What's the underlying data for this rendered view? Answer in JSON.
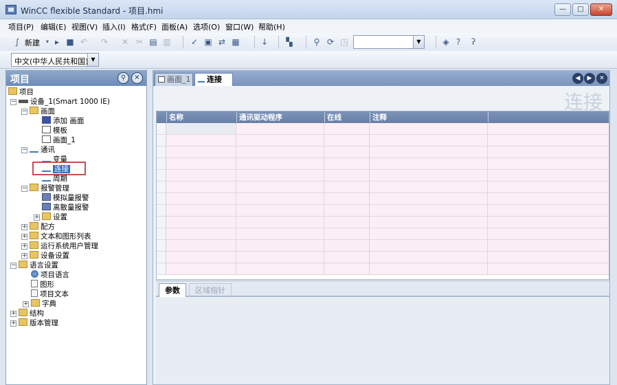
{
  "window": {
    "title": "WinCC flexible Standard - 项目.hmi",
    "controls": [
      "—",
      "□",
      "✕"
    ]
  },
  "menu": [
    "项目(P)",
    "编辑(E)",
    "视图(V)",
    "插入(I)",
    "格式(F)",
    "面板(A)",
    "选项(O)",
    "窗口(W)",
    "帮助(H)"
  ],
  "toolbar": {
    "new_label": "新建",
    "icons": [
      "new-connection-icon",
      "open-icon",
      "save-icon",
      "undo-icon",
      "redo-icon",
      "delete-icon",
      "copy-icon",
      "paste-icon",
      "check-icon",
      "compile-icon",
      "transfer-icon",
      "simulate-icon",
      "download-icon",
      "library-icon",
      "search-icon",
      "link-icon",
      "help-icon"
    ],
    "combo_empty": "",
    "language": "中文(中华人民共和国)"
  },
  "project": {
    "panel_title": "项目",
    "tree": [
      {
        "label": "项目",
        "icon": "project-icon"
      },
      {
        "label": "设备_1(Smart 1000 IE)",
        "icon": "device-icon"
      },
      {
        "label": "画面",
        "icon": "folder-icon"
      },
      {
        "label": "添加 画面",
        "icon": "add-screen-icon"
      },
      {
        "label": "模板",
        "icon": "screen-icon"
      },
      {
        "label": "画面_1",
        "icon": "screen-icon"
      },
      {
        "label": "通讯",
        "icon": "communication-icon"
      },
      {
        "label": "变量",
        "icon": "tag-icon"
      },
      {
        "label": "连接",
        "icon": "connection-icon"
      },
      {
        "label": "周期",
        "icon": "cycle-icon"
      },
      {
        "label": "报警管理",
        "icon": "folder-icon"
      },
      {
        "label": "模拟量报警",
        "icon": "alarm-icon"
      },
      {
        "label": "离散量报警",
        "icon": "alarm-icon"
      },
      {
        "label": "设置",
        "icon": "settings-icon"
      },
      {
        "label": "配方",
        "icon": "folder-icon"
      },
      {
        "label": "文本和图形列表",
        "icon": "folder-icon"
      },
      {
        "label": "运行系统用户管理",
        "icon": "folder-icon"
      },
      {
        "label": "设备设置",
        "icon": "folder-icon"
      },
      {
        "label": "语言设置",
        "icon": "folder-icon"
      },
      {
        "label": "项目语言",
        "icon": "globe-icon"
      },
      {
        "label": "图形",
        "icon": "graphic-icon"
      },
      {
        "label": "项目文本",
        "icon": "doc-icon"
      },
      {
        "label": "字典",
        "icon": "folder-icon"
      },
      {
        "label": "结构",
        "icon": "folder-icon"
      },
      {
        "label": "版本管理",
        "icon": "folder-icon"
      }
    ]
  },
  "editor": {
    "tabs": [
      "画面_1",
      "连接"
    ],
    "title": "连接",
    "columns": [
      "名称",
      "通讯驱动程序",
      "在线",
      "注释"
    ],
    "bottom_tabs": [
      "参数",
      "区域指针"
    ]
  }
}
